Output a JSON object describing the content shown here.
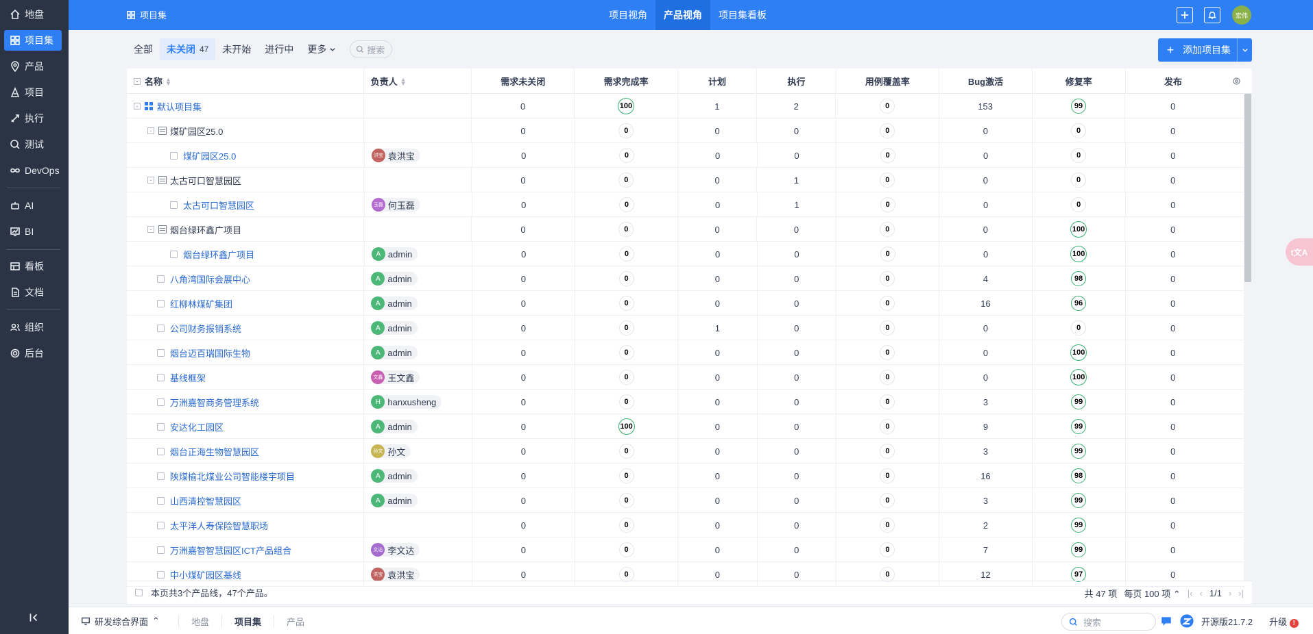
{
  "sidebar": {
    "items": [
      {
        "label": "地盘",
        "icon": "home-icon"
      },
      {
        "label": "项目集",
        "icon": "grid-icon",
        "active": true
      },
      {
        "label": "产品",
        "icon": "location-icon"
      },
      {
        "label": "项目",
        "icon": "project-icon"
      },
      {
        "label": "执行",
        "icon": "rocket-icon"
      },
      {
        "label": "测试",
        "icon": "test-icon"
      },
      {
        "label": "DevOps",
        "icon": "infinity-icon"
      },
      {
        "label": "AI",
        "icon": "robot-icon"
      },
      {
        "label": "BI",
        "icon": "chart-icon"
      },
      {
        "label": "看板",
        "icon": "kanban-icon"
      },
      {
        "label": "文档",
        "icon": "doc-icon"
      },
      {
        "label": "组织",
        "icon": "users-icon"
      },
      {
        "label": "后台",
        "icon": "gear-icon"
      }
    ]
  },
  "header": {
    "title": "项目集",
    "nav": [
      "项目视角",
      "产品视角",
      "项目集看板"
    ],
    "active_nav": "产品视角",
    "avatar_text": "宏伟",
    "brand_color": "#2e7ff4"
  },
  "toolbar": {
    "tabs": [
      {
        "label": "全部"
      },
      {
        "label": "未关闭",
        "count": "47",
        "active": true
      },
      {
        "label": "未开始"
      },
      {
        "label": "进行中"
      },
      {
        "label": "更多"
      }
    ],
    "search_placeholder": "搜索",
    "add_label": "添加项目集"
  },
  "table": {
    "columns": [
      "名称",
      "负责人",
      "需求未关闭",
      "需求完成率",
      "计划",
      "执行",
      "用例覆盖率",
      "Bug激活",
      "修复率",
      "发布"
    ],
    "rows": [
      {
        "name": "默认项目集",
        "kind": "program",
        "owner": "",
        "req_open": "0",
        "req_done": "100",
        "plan": "1",
        "exec": "2",
        "case_cov": "0",
        "bug": "153",
        "fix": "99",
        "release": "0"
      },
      {
        "name": "煤矿园区25.0",
        "kind": "line",
        "owner": "",
        "req_open": "0",
        "req_done": "0",
        "plan": "0",
        "exec": "0",
        "case_cov": "0",
        "bug": "0",
        "fix": "0",
        "release": "0"
      },
      {
        "name": "煤矿园区25.0",
        "kind": "product-nested",
        "owner": "袁洪宝",
        "owner_av": "洪宝",
        "owner_color": "#c0625e",
        "req_open": "0",
        "req_done": "0",
        "plan": "0",
        "exec": "0",
        "case_cov": "0",
        "bug": "0",
        "fix": "0",
        "release": "0"
      },
      {
        "name": "太古可口智慧园区",
        "kind": "line",
        "owner": "",
        "req_open": "0",
        "req_done": "0",
        "plan": "0",
        "exec": "1",
        "case_cov": "0",
        "bug": "0",
        "fix": "0",
        "release": "0"
      },
      {
        "name": "太古可口智慧园区",
        "kind": "product-nested",
        "owner": "何玉磊",
        "owner_av": "玉磊",
        "owner_color": "#b46bcf",
        "req_open": "0",
        "req_done": "0",
        "plan": "0",
        "exec": "1",
        "case_cov": "0",
        "bug": "0",
        "fix": "0",
        "release": "0"
      },
      {
        "name": "烟台绿环鑫广项目",
        "kind": "line",
        "owner": "",
        "req_open": "0",
        "req_done": "0",
        "plan": "0",
        "exec": "0",
        "case_cov": "0",
        "bug": "0",
        "fix": "100",
        "release": "0"
      },
      {
        "name": "烟台绿环鑫广项目",
        "kind": "product-nested",
        "owner": "admin",
        "owner_av": "A",
        "owner_color": "#4bb878",
        "req_open": "0",
        "req_done": "0",
        "plan": "0",
        "exec": "0",
        "case_cov": "0",
        "bug": "0",
        "fix": "100",
        "release": "0"
      },
      {
        "name": "八角湾国际会展中心",
        "kind": "product",
        "owner": "admin",
        "owner_av": "A",
        "owner_color": "#4bb878",
        "req_open": "0",
        "req_done": "0",
        "plan": "0",
        "exec": "0",
        "case_cov": "0",
        "bug": "4",
        "fix": "98",
        "release": "0"
      },
      {
        "name": "红柳林煤矿集团",
        "kind": "product",
        "owner": "admin",
        "owner_av": "A",
        "owner_color": "#4bb878",
        "req_open": "0",
        "req_done": "0",
        "plan": "0",
        "exec": "0",
        "case_cov": "0",
        "bug": "16",
        "fix": "96",
        "release": "0"
      },
      {
        "name": "公司财务报销系统",
        "kind": "product",
        "owner": "admin",
        "owner_av": "A",
        "owner_color": "#4bb878",
        "req_open": "0",
        "req_done": "0",
        "plan": "1",
        "exec": "0",
        "case_cov": "0",
        "bug": "0",
        "fix": "0",
        "release": "0"
      },
      {
        "name": "烟台迈百瑞国际生物",
        "kind": "product",
        "owner": "admin",
        "owner_av": "A",
        "owner_color": "#4bb878",
        "req_open": "0",
        "req_done": "0",
        "plan": "0",
        "exec": "0",
        "case_cov": "0",
        "bug": "0",
        "fix": "100",
        "release": "0"
      },
      {
        "name": "基线框架",
        "kind": "product",
        "owner": "王文鑫",
        "owner_av": "文鑫",
        "owner_color": "#c85fb0",
        "req_open": "0",
        "req_done": "0",
        "plan": "0",
        "exec": "0",
        "case_cov": "0",
        "bug": "0",
        "fix": "100",
        "release": "0"
      },
      {
        "name": "万洲嘉智商务管理系统",
        "kind": "product",
        "owner": "hanxusheng",
        "owner_av": "H",
        "owner_color": "#4bb878",
        "req_open": "0",
        "req_done": "0",
        "plan": "0",
        "exec": "0",
        "case_cov": "0",
        "bug": "3",
        "fix": "99",
        "release": "0"
      },
      {
        "name": "安达化工园区",
        "kind": "product",
        "owner": "admin",
        "owner_av": "A",
        "owner_color": "#4bb878",
        "req_open": "0",
        "req_done": "100",
        "plan": "0",
        "exec": "0",
        "case_cov": "0",
        "bug": "9",
        "fix": "99",
        "release": "0"
      },
      {
        "name": "烟台正海生物智慧园区",
        "kind": "product",
        "owner": "孙文",
        "owner_av": "孙文",
        "owner_color": "#c7b554",
        "req_open": "0",
        "req_done": "0",
        "plan": "0",
        "exec": "0",
        "case_cov": "0",
        "bug": "3",
        "fix": "99",
        "release": "0"
      },
      {
        "name": "陕煤榆北煤业公司智能楼宇项目",
        "kind": "product",
        "owner": "admin",
        "owner_av": "A",
        "owner_color": "#4bb878",
        "req_open": "0",
        "req_done": "0",
        "plan": "0",
        "exec": "0",
        "case_cov": "0",
        "bug": "16",
        "fix": "98",
        "release": "0"
      },
      {
        "name": "山西清控智慧园区",
        "kind": "product",
        "owner": "admin",
        "owner_av": "A",
        "owner_color": "#4bb878",
        "req_open": "0",
        "req_done": "0",
        "plan": "0",
        "exec": "0",
        "case_cov": "0",
        "bug": "3",
        "fix": "99",
        "release": "0"
      },
      {
        "name": "太平洋人寿保险智慧职场",
        "kind": "product",
        "owner": "",
        "req_open": "0",
        "req_done": "0",
        "plan": "0",
        "exec": "0",
        "case_cov": "0",
        "bug": "2",
        "fix": "99",
        "release": "0"
      },
      {
        "name": "万洲嘉智智慧园区ICT产品组合",
        "kind": "product",
        "owner": "李文达",
        "owner_av": "文达",
        "owner_color": "#a56bd0",
        "req_open": "0",
        "req_done": "0",
        "plan": "0",
        "exec": "0",
        "case_cov": "0",
        "bug": "7",
        "fix": "99",
        "release": "0"
      },
      {
        "name": "中小煤矿园区基线",
        "kind": "product",
        "owner": "袁洪宝",
        "owner_av": "洪宝",
        "owner_color": "#c0625e",
        "req_open": "0",
        "req_done": "0",
        "plan": "0",
        "exec": "0",
        "case_cov": "0",
        "bug": "12",
        "fix": "97",
        "release": "0"
      }
    ],
    "footer_summary": "本页共3个产品线，47个产品。",
    "pager": {
      "total": "共 47 项",
      "per_page": "每页 100 项",
      "page": "1/1"
    }
  },
  "bottombar": {
    "app": "研发综合界面",
    "crumbs": [
      "地盘",
      "项目集",
      "产品"
    ],
    "active_crumb": "项目集",
    "search_placeholder": "搜索",
    "version": "开源版21.7.2",
    "upgrade": "升级"
  },
  "float_tool_text": "t文A"
}
